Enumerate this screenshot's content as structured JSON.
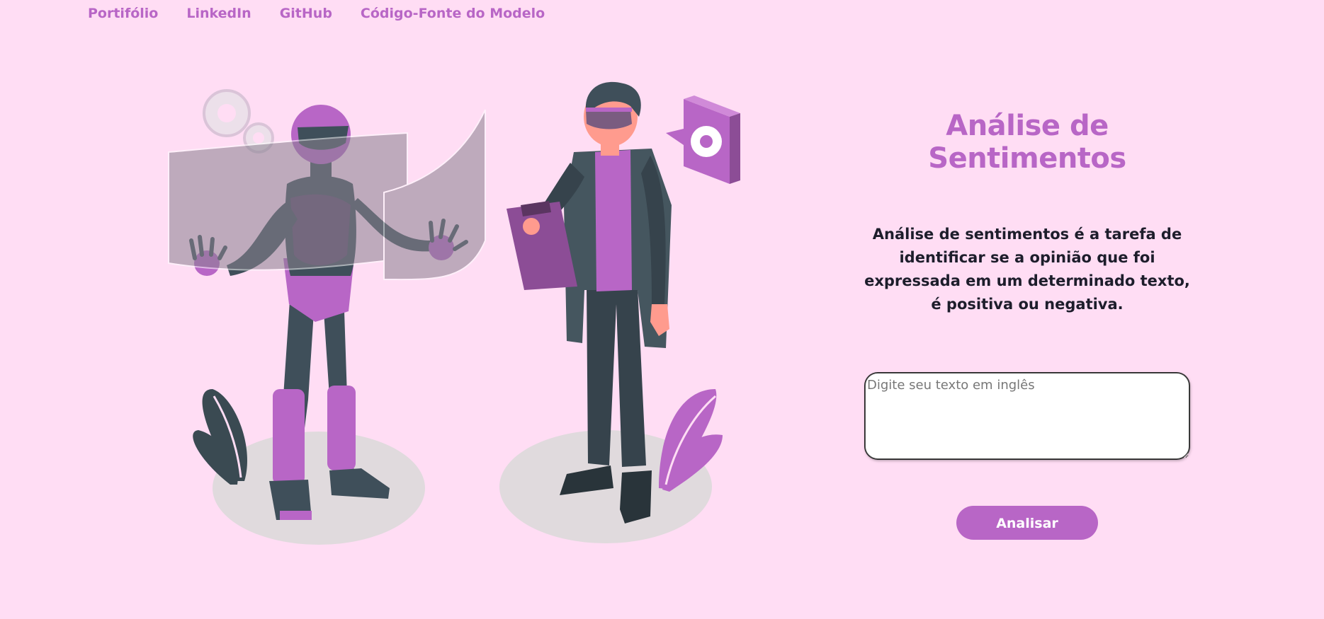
{
  "nav": {
    "items": [
      {
        "label": "Portifólio"
      },
      {
        "label": "LinkedIn"
      },
      {
        "label": "GitHub"
      },
      {
        "label": "Código-Fonte do Modelo"
      }
    ]
  },
  "main": {
    "title": "Análise de Sentimentos",
    "description": "Análise de sentimentos é a tarefa de identificar se a opinião que foi expressada em um determinado texto, é positiva ou negativa.",
    "input": {
      "placeholder": "Digite seu texto em inglês",
      "value": ""
    },
    "button_label": "Analisar"
  },
  "colors": {
    "background": "#ffddf4",
    "accent": "#b866c6",
    "text": "#1d1d2b"
  },
  "icons": [
    "robot-illustration",
    "person-illustration",
    "gear-icon",
    "clipboard-icon",
    "plant-icon"
  ]
}
